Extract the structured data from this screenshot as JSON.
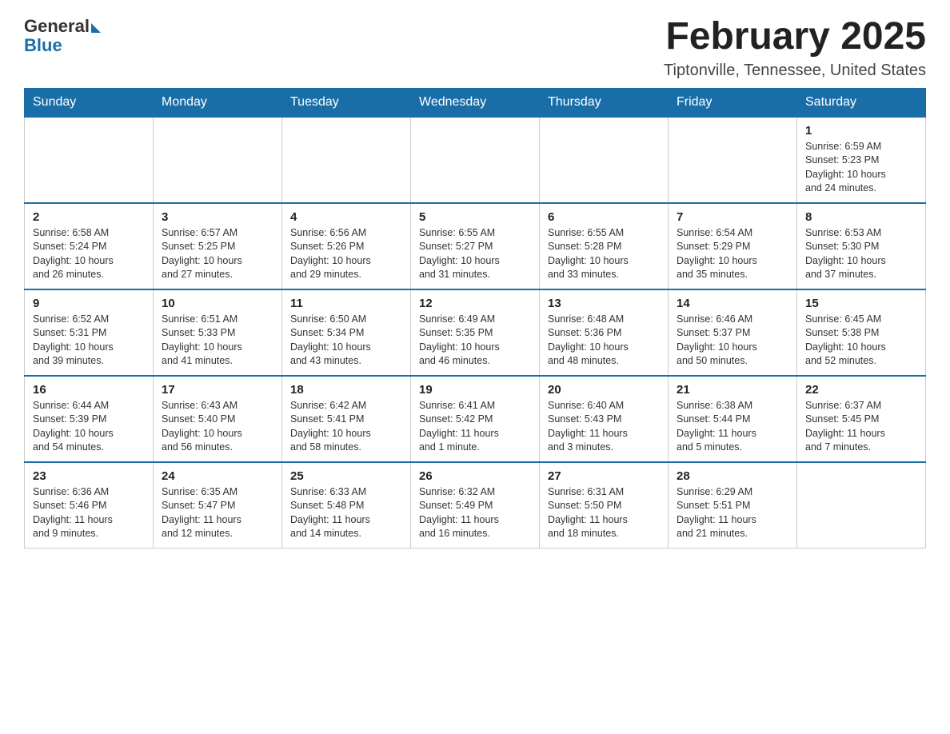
{
  "logo": {
    "general": "General",
    "blue": "Blue"
  },
  "header": {
    "title": "February 2025",
    "location": "Tiptonville, Tennessee, United States"
  },
  "weekdays": [
    "Sunday",
    "Monday",
    "Tuesday",
    "Wednesday",
    "Thursday",
    "Friday",
    "Saturday"
  ],
  "weeks": [
    [
      {
        "day": "",
        "info": ""
      },
      {
        "day": "",
        "info": ""
      },
      {
        "day": "",
        "info": ""
      },
      {
        "day": "",
        "info": ""
      },
      {
        "day": "",
        "info": ""
      },
      {
        "day": "",
        "info": ""
      },
      {
        "day": "1",
        "info": "Sunrise: 6:59 AM\nSunset: 5:23 PM\nDaylight: 10 hours\nand 24 minutes."
      }
    ],
    [
      {
        "day": "2",
        "info": "Sunrise: 6:58 AM\nSunset: 5:24 PM\nDaylight: 10 hours\nand 26 minutes."
      },
      {
        "day": "3",
        "info": "Sunrise: 6:57 AM\nSunset: 5:25 PM\nDaylight: 10 hours\nand 27 minutes."
      },
      {
        "day": "4",
        "info": "Sunrise: 6:56 AM\nSunset: 5:26 PM\nDaylight: 10 hours\nand 29 minutes."
      },
      {
        "day": "5",
        "info": "Sunrise: 6:55 AM\nSunset: 5:27 PM\nDaylight: 10 hours\nand 31 minutes."
      },
      {
        "day": "6",
        "info": "Sunrise: 6:55 AM\nSunset: 5:28 PM\nDaylight: 10 hours\nand 33 minutes."
      },
      {
        "day": "7",
        "info": "Sunrise: 6:54 AM\nSunset: 5:29 PM\nDaylight: 10 hours\nand 35 minutes."
      },
      {
        "day": "8",
        "info": "Sunrise: 6:53 AM\nSunset: 5:30 PM\nDaylight: 10 hours\nand 37 minutes."
      }
    ],
    [
      {
        "day": "9",
        "info": "Sunrise: 6:52 AM\nSunset: 5:31 PM\nDaylight: 10 hours\nand 39 minutes."
      },
      {
        "day": "10",
        "info": "Sunrise: 6:51 AM\nSunset: 5:33 PM\nDaylight: 10 hours\nand 41 minutes."
      },
      {
        "day": "11",
        "info": "Sunrise: 6:50 AM\nSunset: 5:34 PM\nDaylight: 10 hours\nand 43 minutes."
      },
      {
        "day": "12",
        "info": "Sunrise: 6:49 AM\nSunset: 5:35 PM\nDaylight: 10 hours\nand 46 minutes."
      },
      {
        "day": "13",
        "info": "Sunrise: 6:48 AM\nSunset: 5:36 PM\nDaylight: 10 hours\nand 48 minutes."
      },
      {
        "day": "14",
        "info": "Sunrise: 6:46 AM\nSunset: 5:37 PM\nDaylight: 10 hours\nand 50 minutes."
      },
      {
        "day": "15",
        "info": "Sunrise: 6:45 AM\nSunset: 5:38 PM\nDaylight: 10 hours\nand 52 minutes."
      }
    ],
    [
      {
        "day": "16",
        "info": "Sunrise: 6:44 AM\nSunset: 5:39 PM\nDaylight: 10 hours\nand 54 minutes."
      },
      {
        "day": "17",
        "info": "Sunrise: 6:43 AM\nSunset: 5:40 PM\nDaylight: 10 hours\nand 56 minutes."
      },
      {
        "day": "18",
        "info": "Sunrise: 6:42 AM\nSunset: 5:41 PM\nDaylight: 10 hours\nand 58 minutes."
      },
      {
        "day": "19",
        "info": "Sunrise: 6:41 AM\nSunset: 5:42 PM\nDaylight: 11 hours\nand 1 minute."
      },
      {
        "day": "20",
        "info": "Sunrise: 6:40 AM\nSunset: 5:43 PM\nDaylight: 11 hours\nand 3 minutes."
      },
      {
        "day": "21",
        "info": "Sunrise: 6:38 AM\nSunset: 5:44 PM\nDaylight: 11 hours\nand 5 minutes."
      },
      {
        "day": "22",
        "info": "Sunrise: 6:37 AM\nSunset: 5:45 PM\nDaylight: 11 hours\nand 7 minutes."
      }
    ],
    [
      {
        "day": "23",
        "info": "Sunrise: 6:36 AM\nSunset: 5:46 PM\nDaylight: 11 hours\nand 9 minutes."
      },
      {
        "day": "24",
        "info": "Sunrise: 6:35 AM\nSunset: 5:47 PM\nDaylight: 11 hours\nand 12 minutes."
      },
      {
        "day": "25",
        "info": "Sunrise: 6:33 AM\nSunset: 5:48 PM\nDaylight: 11 hours\nand 14 minutes."
      },
      {
        "day": "26",
        "info": "Sunrise: 6:32 AM\nSunset: 5:49 PM\nDaylight: 11 hours\nand 16 minutes."
      },
      {
        "day": "27",
        "info": "Sunrise: 6:31 AM\nSunset: 5:50 PM\nDaylight: 11 hours\nand 18 minutes."
      },
      {
        "day": "28",
        "info": "Sunrise: 6:29 AM\nSunset: 5:51 PM\nDaylight: 11 hours\nand 21 minutes."
      },
      {
        "day": "",
        "info": ""
      }
    ]
  ]
}
